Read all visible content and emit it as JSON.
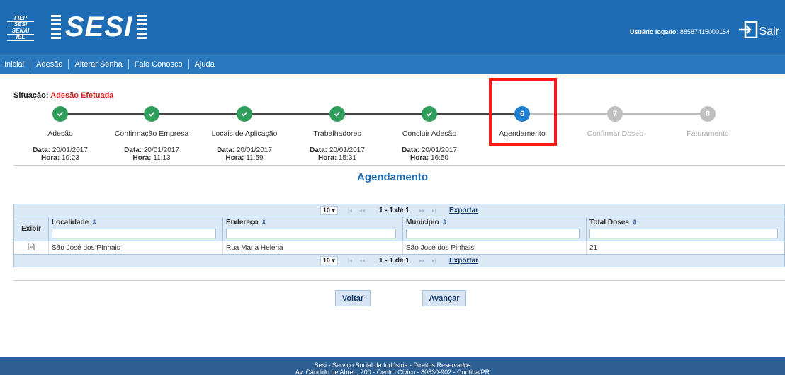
{
  "header": {
    "fiep_lines": [
      "FIEP",
      "SESI",
      "SENAI",
      "IEL"
    ],
    "logo_text": "SESI",
    "user_label": "Usuário logado:",
    "user_value": "88587415000154",
    "logout_label": "Sair"
  },
  "nav": {
    "items": [
      "Inicial",
      "Adesão",
      "Alterar Senha",
      "Fale Conosco",
      "Ajuda"
    ]
  },
  "status": {
    "label": "Situação:",
    "value": "Adesão Efetuada"
  },
  "steps": [
    {
      "number": "1",
      "name": "Adesão",
      "state": "done",
      "date_label": "Data:",
      "date": "20/01/2017",
      "time_label": "Hora:",
      "time": "10:23"
    },
    {
      "number": "2",
      "name": "Confirmação Empresa",
      "state": "done",
      "date_label": "Data:",
      "date": "20/01/2017",
      "time_label": "Hora:",
      "time": "11:13"
    },
    {
      "number": "3",
      "name": "Locais de Aplicação",
      "state": "done",
      "date_label": "Data:",
      "date": "20/01/2017",
      "time_label": "Hora:",
      "time": "11:59"
    },
    {
      "number": "4",
      "name": "Trabalhadores",
      "state": "done",
      "date_label": "Data:",
      "date": "20/01/2017",
      "time_label": "Hora:",
      "time": "15:31"
    },
    {
      "number": "5",
      "name": "Concluir Adesão",
      "state": "done",
      "date_label": "Data:",
      "date": "20/01/2017",
      "time_label": "Hora:",
      "time": "16:50"
    },
    {
      "number": "6",
      "name": "Agendamento",
      "state": "current"
    },
    {
      "number": "7",
      "name": "Confirmar Doses",
      "state": "future"
    },
    {
      "number": "8",
      "name": "Faturamento",
      "state": "future"
    }
  ],
  "page_title": "Agendamento",
  "table": {
    "page_size": "10",
    "page_info": "1 - 1 de 1",
    "export_label": "Exportar",
    "columns": [
      "Exibir",
      "Localidade",
      "Endereço",
      "Município",
      "Total Doses"
    ],
    "rows": [
      {
        "localidade": "São José dos PInhais",
        "endereco": "Rua Maria Helena",
        "municipio": "São José dos Pinhais",
        "total_doses": "21"
      }
    ]
  },
  "buttons": {
    "back": "Voltar",
    "next": "Avançar"
  },
  "footer": {
    "line1": "Sesi - Serviço Social da Indústria - Direitos Reservados",
    "line2": "Av. Cândido de Abreu, 200 - Centro Cívico - 80530-902 - Curitiba/PR"
  },
  "colors": {
    "header_blue": "#1e6cb3",
    "done_green": "#2e9e5a",
    "current_blue": "#1e7fd0",
    "status_red": "#d42020",
    "highlight_red": "#ff1a1a"
  }
}
